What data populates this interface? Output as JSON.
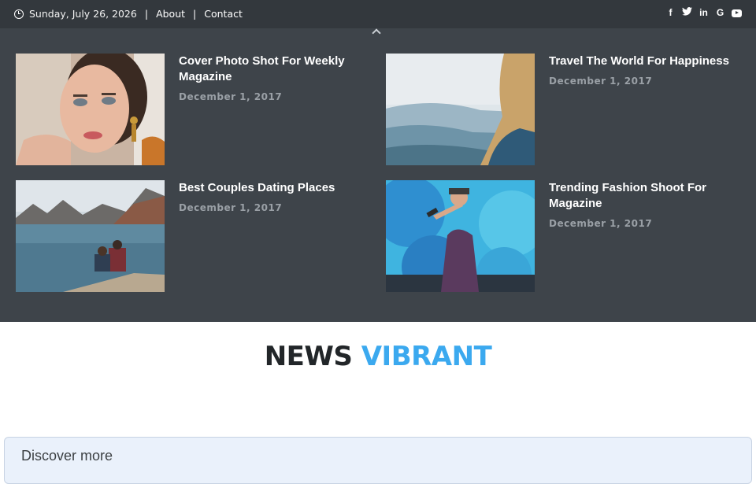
{
  "topbar": {
    "date": "Sunday, July 26, 2026",
    "links": [
      "About",
      "Contact"
    ],
    "social_icons": [
      "facebook-icon",
      "twitter-icon",
      "linkedin-icon",
      "google-icon",
      "youtube-icon"
    ],
    "social_glyphs": {
      "facebook": "f",
      "twitter": "t",
      "linkedin": "in",
      "google": "G"
    }
  },
  "posts": [
    {
      "title": "Cover Photo Shot For Weekly Magazine",
      "date": "December 1, 2017"
    },
    {
      "title": "Travel The World For Happiness",
      "date": "December 1, 2017"
    },
    {
      "title": "Best Couples Dating Places",
      "date": "December 1, 2017"
    },
    {
      "title": "Trending Fashion Shoot For Magazine",
      "date": "December 1, 2017"
    }
  ],
  "site": {
    "title_part1": "NEWS ",
    "title_part2": "VIBRANT"
  },
  "discover": {
    "label": "Discover more"
  },
  "colors": {
    "topbar_bg": "#33383d",
    "panel_bg": "#3e444a",
    "accent": "#3ba9ef",
    "discover_bg": "#eaf1fb"
  }
}
